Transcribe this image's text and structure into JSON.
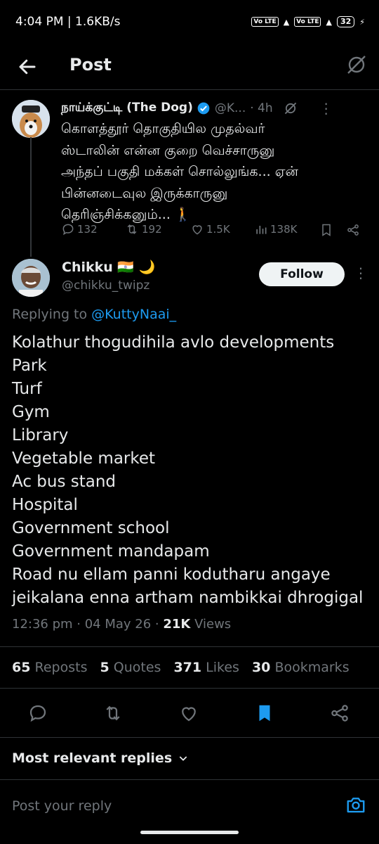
{
  "status_bar": {
    "time_speed": "4:04 PM | 1.6KB/s",
    "sim1": "Vo LTE",
    "sim2": "Vo LTE",
    "battery": "32"
  },
  "header": {
    "title": "Post"
  },
  "quoted_tweet": {
    "name": "நாய்க்குட்டி (The Dog)",
    "handle": "@K...",
    "time": "· 4h",
    "text_lines": [
      "கொளத்தூர் தொகுதியில முதல்வர்",
      "ஸ்டாலின் என்ன குறை வெச்சாருனு",
      "அந்தப் பகுதி மக்கள் சொல்லுங்க... ஏன்",
      "பின்னடைவுல இருக்காருனு",
      "தெரிஞ்சிக்கனும்... 🚶"
    ],
    "replies": "132",
    "reposts": "192",
    "likes": "1.5K",
    "views": "138K"
  },
  "main_tweet": {
    "name": "Chikku 🇮🇳 🌙",
    "handle": "@chikku_twipz",
    "follow_label": "Follow",
    "replying_prefix": "Replying to",
    "replying_to": "@KuttyNaai_",
    "body_lines": [
      "Kolathur thogudihila avlo developments",
      "Park",
      "Turf",
      "Gym",
      "Library",
      "Vegetable market",
      "Ac bus stand",
      "Hospital",
      "Government school",
      "Government mandapam",
      "Road nu ellam panni kodutharu angaye",
      "jeikalana enna artham nambikkai dhrogigal"
    ],
    "timestamp": "12:36 pm · 04 May 26 · ",
    "views_count": "21K",
    "views_label": " Views"
  },
  "stats": {
    "reposts_count": "65",
    "reposts_label": "Reposts",
    "quotes_count": "5",
    "quotes_label": "Quotes",
    "likes_count": "371",
    "likes_label": "Likes",
    "bookmarks_count": "30",
    "bookmarks_label": "Bookmarks"
  },
  "replies_section": {
    "sort_label": "Most relevant replies"
  },
  "reply_bar": {
    "placeholder": "Post your reply"
  },
  "colors": {
    "accent": "#1d9bf0",
    "muted": "#71767b",
    "text": "#e7e9ea",
    "divider": "#2f3336"
  }
}
